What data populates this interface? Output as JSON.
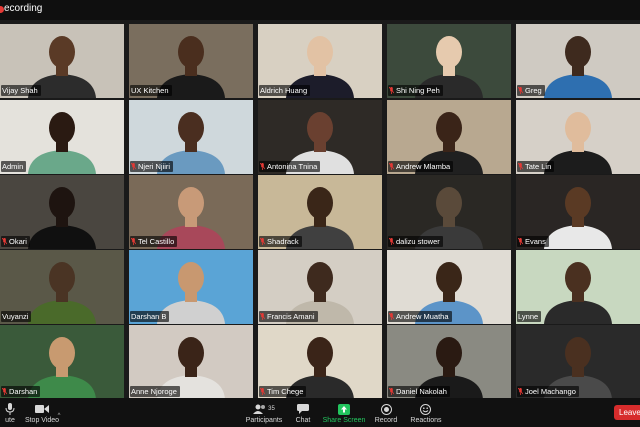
{
  "recording": {
    "label": "ecording"
  },
  "tiles": [
    {
      "name": "Vijay Shah",
      "muted": false,
      "active": true,
      "bg": "#c8c2b8",
      "skin": "#5a3a26",
      "shirt": "#2c2c2c"
    },
    {
      "name": "UX Kitchen",
      "muted": false,
      "active": false,
      "bg": "#7a6e5e",
      "skin": "#4a2e1e",
      "shirt": "#1a1a1a"
    },
    {
      "name": "Aldrich Huang",
      "muted": false,
      "active": false,
      "bg": "#d8d0c2",
      "skin": "#e2c2a4",
      "shirt": "#1c1c2a"
    },
    {
      "name": "Shi Ning Peh",
      "muted": true,
      "active": false,
      "bg": "#3c4a3c",
      "skin": "#e6caae",
      "shirt": "#2a2a2a"
    },
    {
      "name": "Greg",
      "muted": true,
      "active": false,
      "bg": "#cfcac2",
      "skin": "#3e2a1e",
      "shirt": "#2e6fb0"
    },
    {
      "name": "Admin",
      "muted": false,
      "active": false,
      "bg": "#e4e2dc",
      "skin": "#2a1a12",
      "shirt": "#6aa88a"
    },
    {
      "name": "Njeri Njiiri",
      "muted": true,
      "active": false,
      "bg": "#cfd8dc",
      "skin": "#4a2e20",
      "shirt": "#6a9ac0"
    },
    {
      "name": "Antonina Tnina",
      "muted": true,
      "active": false,
      "bg": "#2e2a26",
      "skin": "#6a4030",
      "shirt": "#e0e0e0"
    },
    {
      "name": "Andrew Mlamba",
      "muted": true,
      "active": false,
      "bg": "#b8a890",
      "skin": "#3a2418",
      "shirt": "#202020"
    },
    {
      "name": "Tate Lin",
      "muted": true,
      "active": false,
      "bg": "#d6d0c8",
      "skin": "#e0bc9c",
      "shirt": "#1c1c1c"
    },
    {
      "name": "Okari",
      "muted": true,
      "active": false,
      "bg": "#4a4640",
      "skin": "#1e1410",
      "shirt": "#101010"
    },
    {
      "name": "Tel Castillo",
      "muted": true,
      "active": false,
      "bg": "#7a6a58",
      "skin": "#c89a78",
      "shirt": "#a8485a"
    },
    {
      "name": "Shadrack",
      "muted": true,
      "active": false,
      "bg": "#c8b898",
      "skin": "#3a2618",
      "shirt": "#404040"
    },
    {
      "name": "dalizu stower",
      "muted": true,
      "active": false,
      "bg": "#2a2824",
      "skin": "#5a4a3a",
      "shirt": "#3a3a3a"
    },
    {
      "name": "Evans",
      "muted": true,
      "active": false,
      "bg": "#2a2624",
      "skin": "#5a3a24",
      "shirt": "#e8e8e8"
    },
    {
      "name": "Vuyanzi",
      "muted": false,
      "active": false,
      "bg": "#5a5848",
      "skin": "#4a3424",
      "shirt": "#4a6a2a"
    },
    {
      "name": "Darshan B",
      "muted": false,
      "active": false,
      "bg": "#5aa4d6",
      "skin": "#c89870",
      "shirt": "#d0d0d0"
    },
    {
      "name": "Francis Amani",
      "muted": true,
      "active": false,
      "bg": "#d4cec4",
      "skin": "#3e2a1e",
      "shirt": "#bfb8aa"
    },
    {
      "name": "Andrew Muatha",
      "muted": true,
      "active": false,
      "bg": "#e0dcd4",
      "skin": "#3a2618",
      "shirt": "#5c94c8"
    },
    {
      "name": "Lynne",
      "muted": false,
      "active": false,
      "bg": "#c8d8c0",
      "skin": "#4a3020",
      "shirt": "#2a2a2a"
    },
    {
      "name": "Darshan",
      "muted": true,
      "active": false,
      "bg": "#3a5a3a",
      "skin": "#c89a70",
      "shirt": "#3e8a4a"
    },
    {
      "name": "Anne Njoroge",
      "muted": false,
      "active": false,
      "bg": "#d2cac2",
      "skin": "#3a2418",
      "shirt": "#e4e2de"
    },
    {
      "name": "Tim Chege",
      "muted": true,
      "active": false,
      "bg": "#e0d8c8",
      "skin": "#3a2418",
      "shirt": "#2a2a2a"
    },
    {
      "name": "Daniel Nakolah",
      "muted": true,
      "active": false,
      "bg": "#8a8a82",
      "skin": "#2a1a12",
      "shirt": "#1a1a1a"
    },
    {
      "name": "Joel Machango",
      "muted": true,
      "active": false,
      "bg": "#2a2a2a",
      "skin": "#4a3020",
      "shirt": "#4a4a4a"
    }
  ],
  "toolbar": {
    "mute_label": "ute",
    "stop_video_label": "Stop Video",
    "participants_label": "Participants",
    "participants_count": "35",
    "chat_label": "Chat",
    "share_label": "Share Screen",
    "record_label": "Record",
    "reactions_label": "Reactions",
    "leave_label": "Leave"
  },
  "colors": {
    "active_outline": "#d6d64a",
    "muted": "#e53935",
    "share": "#22c55e",
    "leave": "#d72c2c"
  }
}
